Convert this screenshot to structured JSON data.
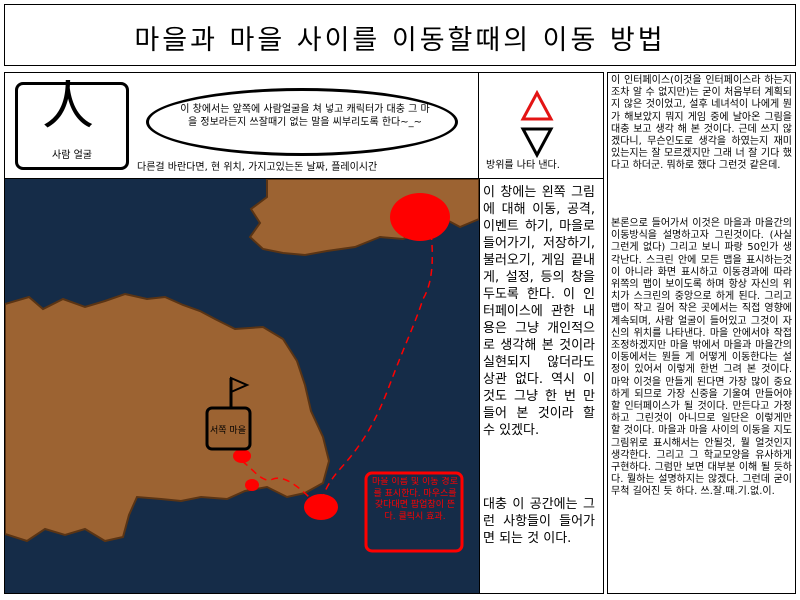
{
  "title": "마을과 마을 사이를 이동할때의 이동 방법",
  "face": {
    "glyph": "人",
    "label": "사람 얼굴"
  },
  "speech": "이 창에서는 앞쪽에 사람얼굴을 쳐 넣고 캐릭터가 대충 그 마을 정보라든지 쓰잘때기 없는 말을 씨부리도록 한다~_~",
  "status_line": "다른걸 바란다면, 현 위치, 가지고있는돈 날짜, 플레이시간",
  "direction": {
    "label": "방위를 나타 낸다.",
    "up_color": "#e31414",
    "down_color": "#000000"
  },
  "map": {
    "water_color": "#152c48",
    "land_color": "#9c6332",
    "marker_color": "#ff0000",
    "town_label": "서쪽 마을",
    "annotation": "마을 이름 및 이동 경로를 표시한다. 마우스를 갖다대면 팝업창이 뜬다. 클릭시 효과.",
    "annotation_border": "#ff0000"
  },
  "map_desc": "이 창에는 왼쪽 그림에 대해 이동, 공격, 이벤트 하기, 마을로 들어가기, 저장하기, 불러오기, 게임 끝내게, 설정, 등의 창을 두도록 한다. 이 인터페이스에 관한 내용은 그냥 개인적으로 생각해 본 것이라 실현되지 않더라도 상관 없다. 역시 이것도 그냥 한 번 만들어 본 것이라 할 수 있겠다.",
  "map_desc2": "대충 이 공간에는 그런 사항들이 들어가면 되는 것 이다.",
  "side_text1": "이 인터페이스(이것을 인터페이스라 하는지조차 알 수 없지만)는 굳이 처음부터 계획되지 않은 것이었고, 설후 네녀석이 나에게 뭔가 해보았지 뭐지 게임 중에 날아온 그림을 대충 보고 생각 해 본 것이다. 근데 쓰지 않겠다니, 무슨인도로 생각을 하였는지 재미 있는지는 잘 모르겠지만 그래 너 잘 기다 했다고 하더군. 뭐하로 했다 그런것 같은데.",
  "side_text2": "본론으로 들어가서 이것은 마을과 마을간의 이동방식을 설명하고자 그린것이다. (사실 그런게 없다) 그리고 보니 파랑 50인가 생각난다. 스크린 안에 모든 맵을 표시하는것이 아니라 화면 표시하고 이동경과에 따라 위쪽의 맵이 보이도록 하며 항상 자신의 위치가 스크린의 중앙으로 하게 된다. 그리고 맵이 작고 길어 작은 곳에서는 직접 영향에 계속되며, 사람 얼굴이 들어있고 그것이 자신의 위치를 나타낸다. 마을 안에서야 작접 조정하겠지만 마을 밖에서 마을과 마을간의 이동에서는 뭔들 게 어떻게 이동한다는 설정이 있어서 이렇게 한번 그려 본 것이다. 마악 이것을 만들게 된다면 가장 많이 중요 하게 되므로 가장 신중을 기울여 만들어야 할 인터페이스가 될 것이다. 만든다고 가정하고 그린것이 아니므로 일단은 이렇게만 할 것이다. 마을과 마을 사이의 이동을 지도 그림위로 표시해서는 안될것, 뭘 얼것인지 생각한다. 그리고 그 학교모양을 유사하게 구현하다. 그럼만 보면 대부분 이해 될 듯하다. 뭘하는 설명하지는 않겠다. 그런데 굳이 무척 길어진 듯 하다. 쓰.잘.때.기.없.이."
}
